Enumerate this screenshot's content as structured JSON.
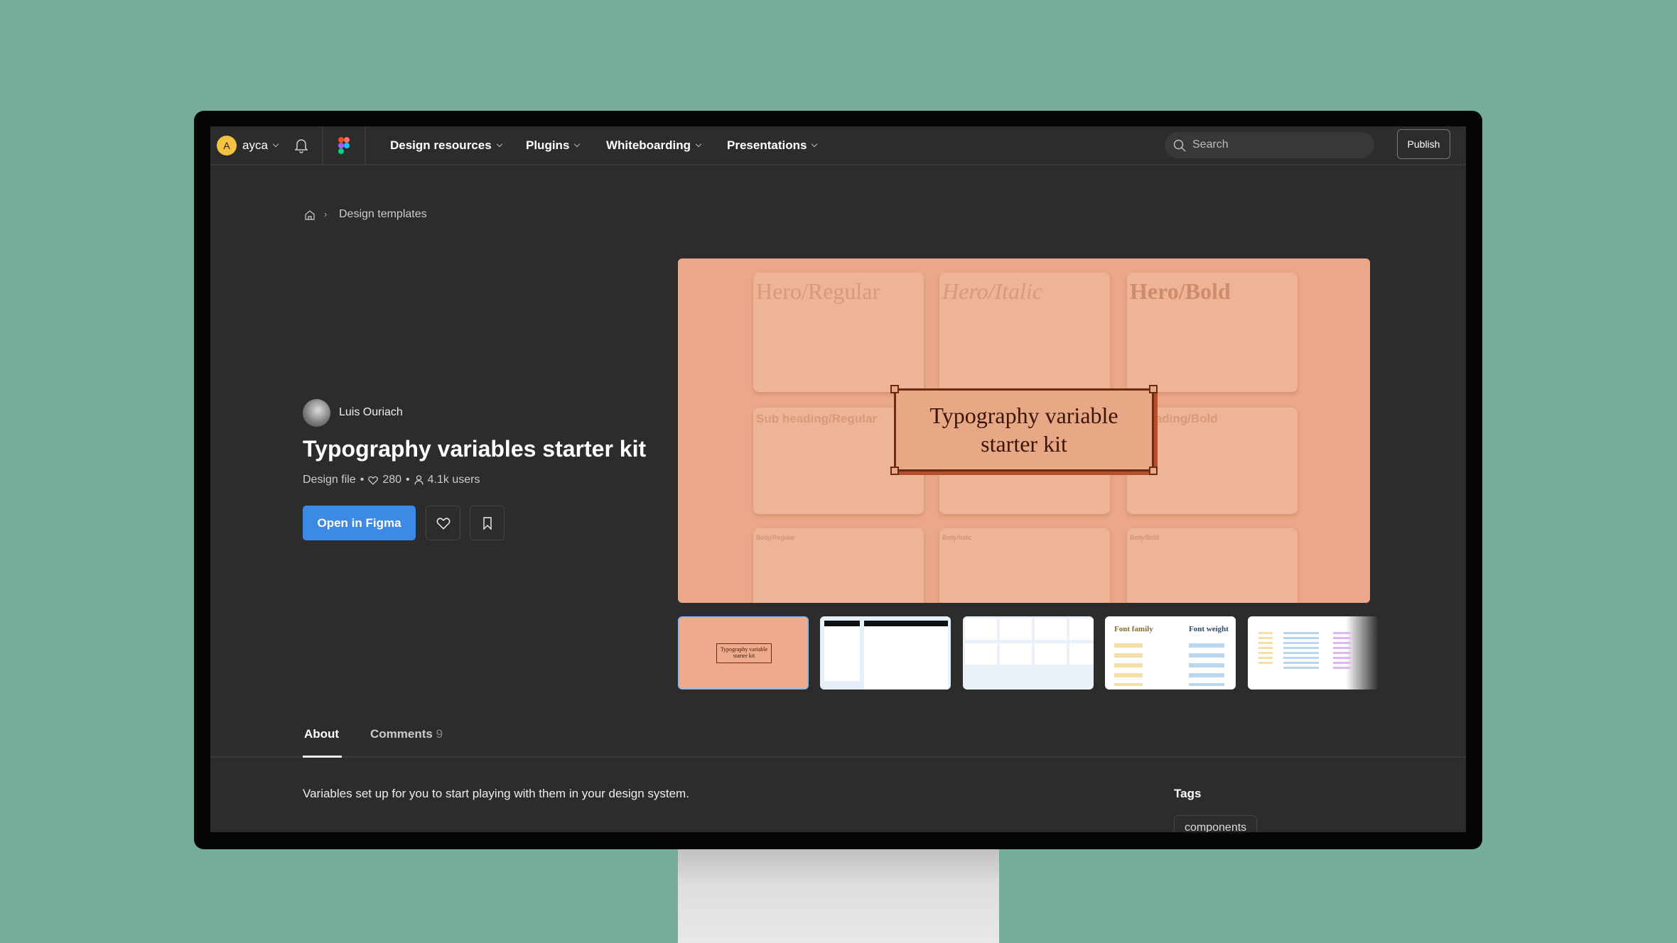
{
  "nav": {
    "user": {
      "initial": "A",
      "name": "ayca",
      "avatar_color": "#f5c242"
    },
    "menu": [
      {
        "label": "Design resources"
      },
      {
        "label": "Plugins"
      },
      {
        "label": "Whiteboarding"
      },
      {
        "label": "Presentations"
      }
    ],
    "search_placeholder": "Search",
    "publish_label": "Publish"
  },
  "breadcrumb": {
    "current": "Design templates"
  },
  "file": {
    "author": "Luis Ouriach",
    "title": "Typography variables starter kit",
    "type": "Design file",
    "likes": "280",
    "users": "4.1k users",
    "open_label": "Open in Figma",
    "accent": "#3d8ae6"
  },
  "preview": {
    "cards": [
      "Hero/Regular",
      "Hero/Italic",
      "Hero/Bold",
      "Sub heading/Regular",
      "heading/Bold",
      "Body/Regular",
      "Body/Italic",
      "Body/Bold"
    ],
    "banner_line1": "Typography variable",
    "banner_line2": "starter kit",
    "bg_color": "#eaa888",
    "thumbs": [
      {
        "label": "Typography variable starter kit"
      },
      {
        "label": ""
      },
      {
        "label": ""
      },
      {
        "label1": "Font family",
        "label2": "Font weight"
      },
      {
        "label": ""
      }
    ]
  },
  "tabs": [
    {
      "label": "About",
      "active": true
    },
    {
      "label": "Comments",
      "count": "9"
    }
  ],
  "about": {
    "description": "Variables set up for you to start playing with them in your design system.",
    "tags_heading": "Tags",
    "tags": [
      "components"
    ]
  }
}
